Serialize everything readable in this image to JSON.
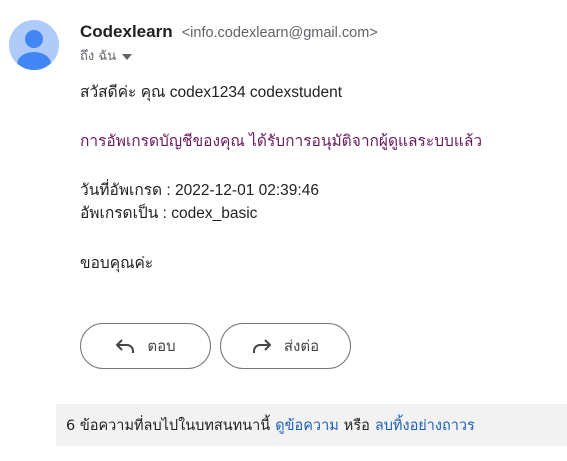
{
  "sender": {
    "name": "Codexlearn",
    "email": "<info.codexlearn@gmail.com>",
    "avatar_icon": "person-icon"
  },
  "recipient": {
    "label": "ถึง ฉัน",
    "expand_icon": "caret-down-icon"
  },
  "message": {
    "greeting": "สวัสดีค่ะ คุณ codex1234 codexstudent",
    "approval": "การอัพเกรดบัญชีของคุณ ได้รับการอนุมัติจากผู้ดูแลระบบแล้ว",
    "upgrade_date": "วันที่อัพเกรด : 2022-12-01 02:39:46",
    "upgrade_to": "อัพเกรดเป็น : codex_basic",
    "closing": "ขอบคุณค่ะ"
  },
  "actions": {
    "reply_label": "ตอบ",
    "reply_icon": "reply-arrow-icon",
    "forward_label": "ส่งต่อ",
    "forward_icon": "forward-arrow-icon"
  },
  "notice": {
    "text": "6 ข้อความที่ลบไปในบทสนทนานี้",
    "view_link": "ดูข้อความ",
    "or": "หรือ",
    "delete_link": "ลบทิ้งอย่างถาวร"
  },
  "colors": {
    "approval_text": "#6a1b5e",
    "link": "#1a5fb4",
    "avatar_bg": "#aecbfa",
    "avatar_fg": "#4285f4"
  }
}
